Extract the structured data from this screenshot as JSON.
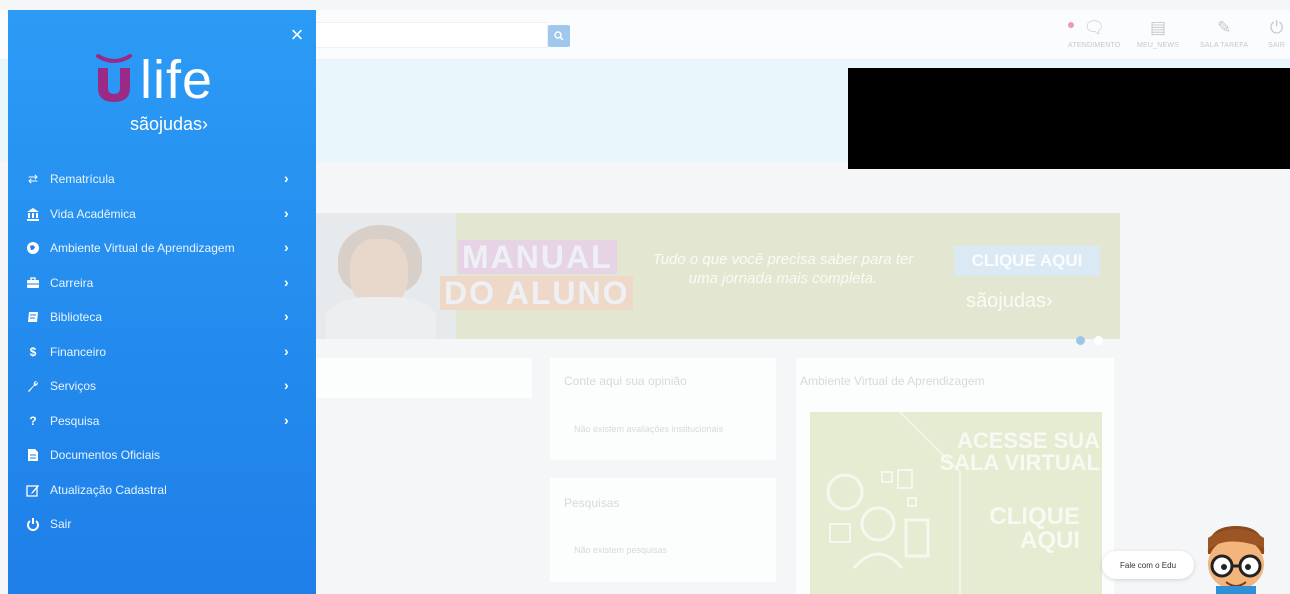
{
  "search": {
    "placeholder": "",
    "button_icon": "search-icon"
  },
  "toolbar": [
    {
      "icon": "chat-icon",
      "label": "ATENDIMENTO"
    },
    {
      "icon": "news-icon",
      "label": "MEU_NEWS"
    },
    {
      "icon": "edit-icon",
      "label": "SALA TAREFA"
    },
    {
      "icon": "power-icon",
      "label": "SAIR"
    }
  ],
  "banner": {
    "title_line1": "MANUAL",
    "title_line2": "DO ALUNO",
    "tagline": "Tudo o que você precisa saber para ter uma jornada mais completa.",
    "cta": "CLIQUE AQUI",
    "brand": "sãojudas›"
  },
  "cards": {
    "opinion": {
      "title": "Conte aqui sua opinião",
      "empty": "Não existem avaliações institucionais"
    },
    "surveys": {
      "title": "Pesquisas",
      "empty": "Não existem pesquisas"
    },
    "virtual": {
      "title": "Ambiente Virtual de Aprendizagem",
      "line1": "ACESSE SUA",
      "line2": "SALA VIRTUAL",
      "cta1": "CLIQUE",
      "cta2": "AQUI"
    }
  },
  "chat": {
    "label": "Fale com o Edu"
  },
  "side_menu": {
    "logo_main": "life",
    "logo_sub": "sãojudas›",
    "close": "×",
    "items": [
      {
        "icon": "swap-icon",
        "glyph": "⇄",
        "label": "Rematrícula",
        "chevron": true
      },
      {
        "icon": "institution-icon",
        "glyph": "🏛",
        "label": "Vida Acadêmica",
        "chevron": true
      },
      {
        "icon": "globe-icon",
        "glyph": "●",
        "label": "Ambiente Virtual de Aprendizagem",
        "chevron": true
      },
      {
        "icon": "briefcase-icon",
        "glyph": "▬",
        "label": "Carreira",
        "chevron": true
      },
      {
        "icon": "book-icon",
        "glyph": "▰",
        "label": "Biblioteca",
        "chevron": true
      },
      {
        "icon": "dollar-icon",
        "glyph": "$",
        "label": "Financeiro",
        "chevron": true
      },
      {
        "icon": "wrench-icon",
        "glyph": "✎",
        "label": "Serviços",
        "chevron": true
      },
      {
        "icon": "question-icon",
        "glyph": "?",
        "label": "Pesquisa",
        "chevron": true
      },
      {
        "icon": "document-icon",
        "glyph": "▤",
        "label": "Documentos Oficiais",
        "chevron": false
      },
      {
        "icon": "edit-icon",
        "glyph": "✎",
        "label": "Atualização Cadastral",
        "chevron": false
      },
      {
        "icon": "power-icon",
        "glyph": "⏻",
        "label": "Sair",
        "chevron": false
      }
    ]
  }
}
